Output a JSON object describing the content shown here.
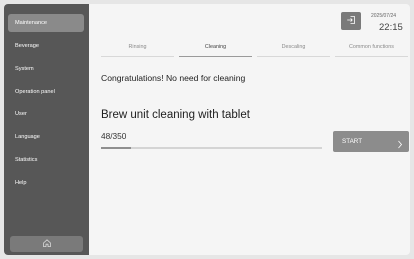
{
  "sidebar": {
    "items": [
      {
        "label": "Maintenance",
        "active": true
      },
      {
        "label": "Beverage",
        "active": false
      },
      {
        "label": "System",
        "active": false
      },
      {
        "label": "Operation panel",
        "active": false
      },
      {
        "label": "User",
        "active": false
      },
      {
        "label": "Language",
        "active": false
      },
      {
        "label": "Statistics",
        "active": false
      },
      {
        "label": "Help",
        "active": false
      }
    ],
    "home_icon": "home-icon"
  },
  "header": {
    "logout_icon": "logout-icon",
    "date": "2025/07/24",
    "time": "22:15"
  },
  "tabs": [
    {
      "label": "Rinsing",
      "active": false
    },
    {
      "label": "Cleaning",
      "active": true
    },
    {
      "label": "Descaling",
      "active": false
    },
    {
      "label": "Common functions",
      "active": false
    }
  ],
  "main": {
    "message": "Congratulations! No need for cleaning",
    "title": "Brew unit cleaning with tablet",
    "counter": "48/350",
    "progress_value": 48,
    "progress_max": 350,
    "start_label": "START",
    "start_icon": "chevron-right-icon"
  },
  "colors": {
    "sidebar_bg": "#575757",
    "active_item_bg": "#8a8a8a",
    "button_bg": "#8c8c8c"
  }
}
